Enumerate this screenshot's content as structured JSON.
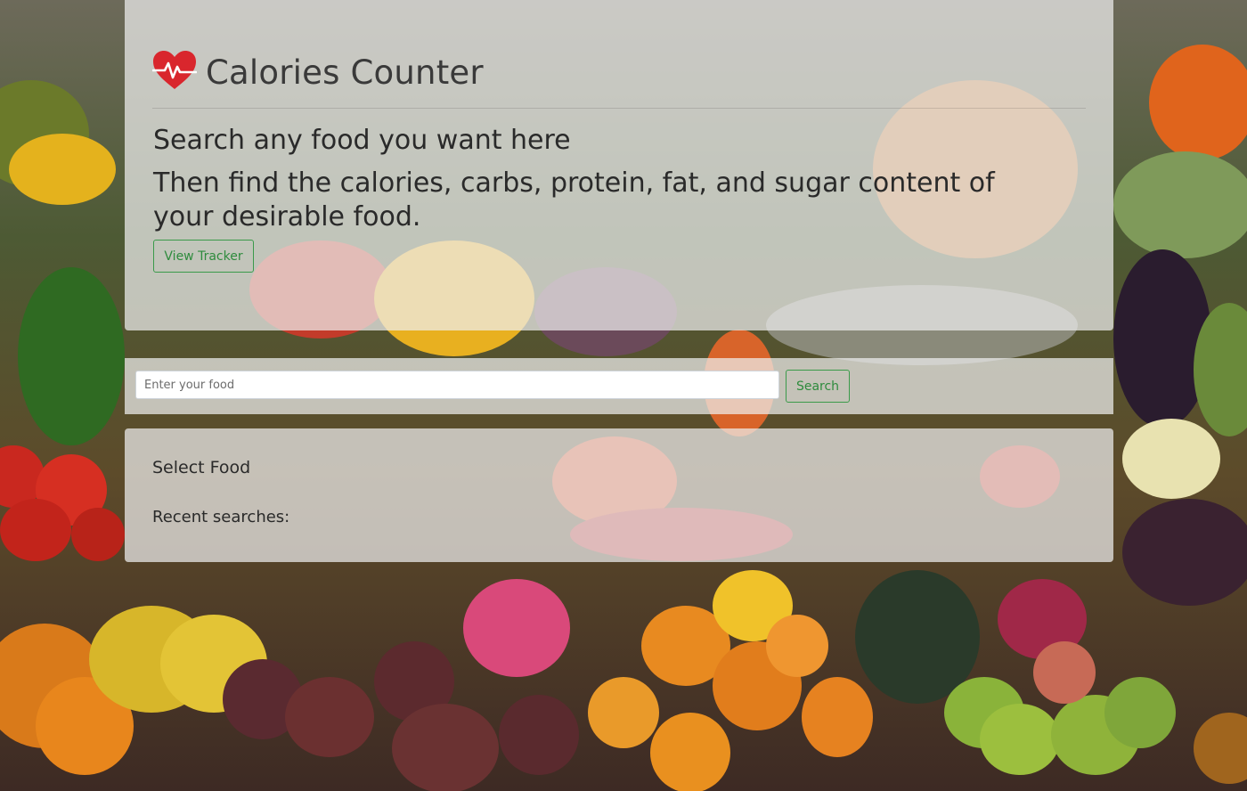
{
  "header": {
    "title": "Calories Counter",
    "logo_icon": "heartbeat-icon",
    "accent_color": "#d9262d"
  },
  "hero": {
    "line1": "Search any food you want here",
    "line2": "Then find the calories, carbs, protein, fat, and sugar content of your desirable food.",
    "view_tracker_label": "View Tracker"
  },
  "search": {
    "placeholder": "Enter your food",
    "value": "",
    "button_label": "Search",
    "button_color": "#2e8b3d"
  },
  "results": {
    "select_label": "Select Food",
    "recent_label": "Recent searches:"
  }
}
